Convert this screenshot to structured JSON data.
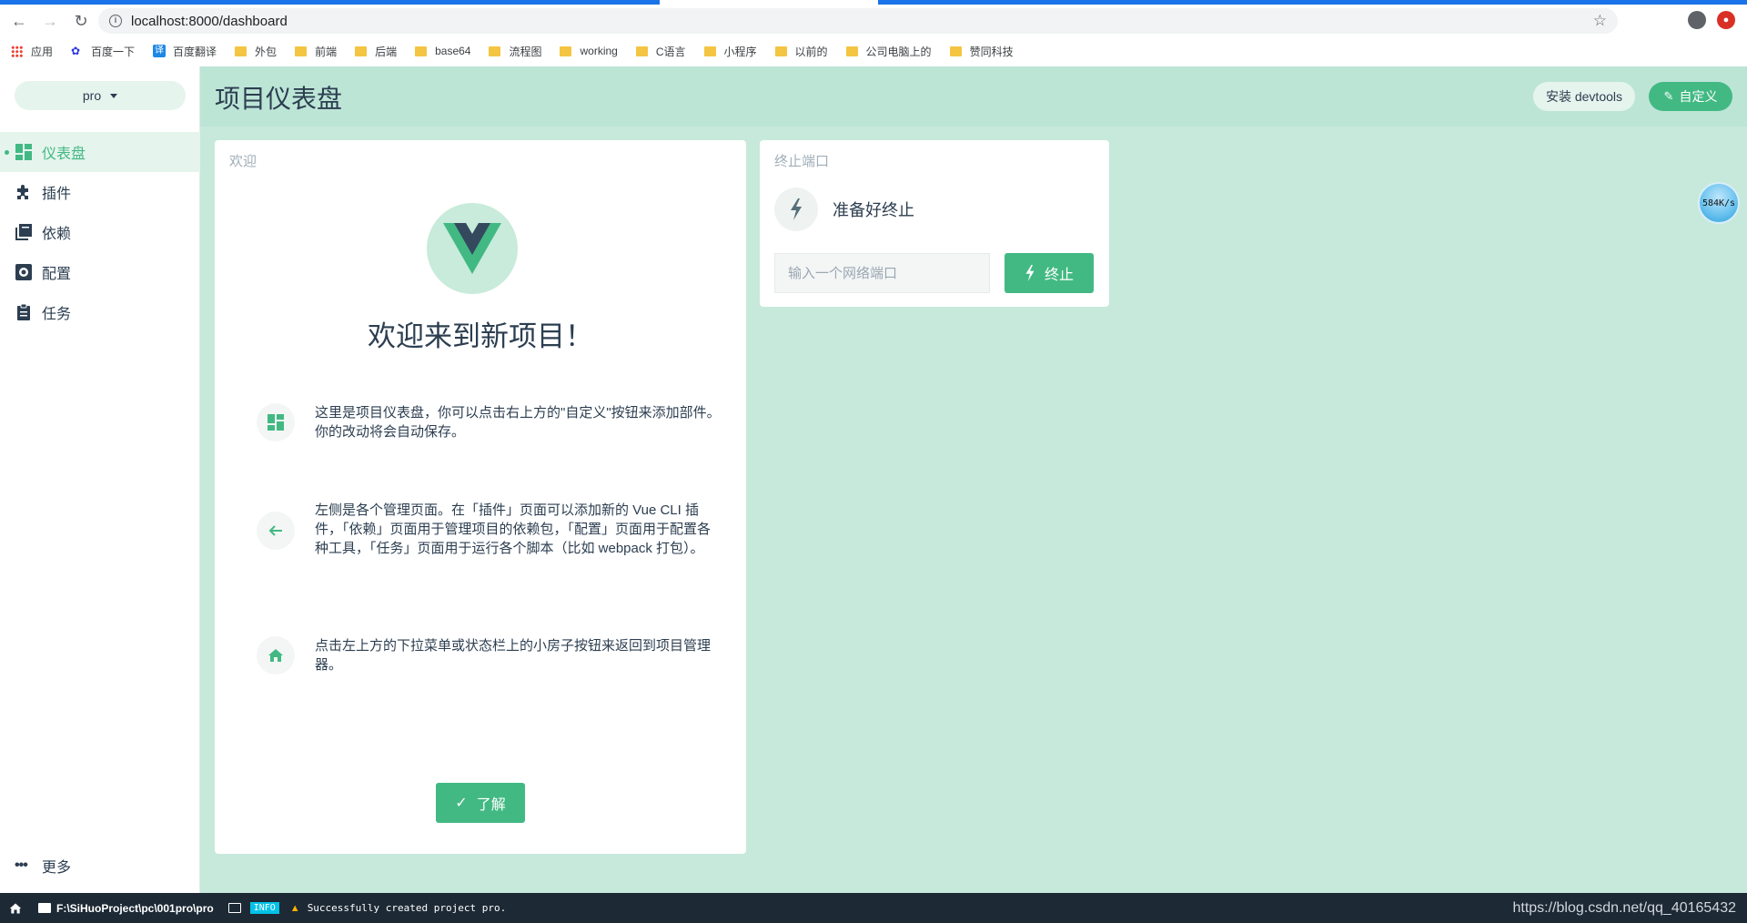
{
  "browser": {
    "url": "localhost:8000/dashboard",
    "bookmarks": [
      {
        "label": "应用",
        "icon": "apps-icon"
      },
      {
        "label": "百度一下",
        "icon": "baidu-paw-icon"
      },
      {
        "label": "百度翻译",
        "icon": "baidu-translate-icon"
      },
      {
        "label": "外包",
        "icon": "folder-icon"
      },
      {
        "label": "前端",
        "icon": "folder-icon"
      },
      {
        "label": "后端",
        "icon": "folder-icon"
      },
      {
        "label": "base64",
        "icon": "folder-icon"
      },
      {
        "label": "流程图",
        "icon": "folder-icon"
      },
      {
        "label": "working",
        "icon": "folder-icon"
      },
      {
        "label": "C语言",
        "icon": "folder-icon"
      },
      {
        "label": "小程序",
        "icon": "folder-icon"
      },
      {
        "label": "以前的",
        "icon": "folder-icon"
      },
      {
        "label": "公司电脑上的",
        "icon": "folder-icon"
      },
      {
        "label": "赞同科技",
        "icon": "folder-icon"
      }
    ]
  },
  "sidebar": {
    "project_name": "pro",
    "items": [
      {
        "label": "仪表盘",
        "icon": "dashboard-icon",
        "active": true
      },
      {
        "label": "插件",
        "icon": "puzzle-icon",
        "active": false
      },
      {
        "label": "依赖",
        "icon": "library-icon",
        "active": false
      },
      {
        "label": "配置",
        "icon": "settings-icon",
        "active": false
      },
      {
        "label": "任务",
        "icon": "clipboard-icon",
        "active": false
      }
    ],
    "more_label": "更多"
  },
  "header": {
    "title": "项目仪表盘",
    "devtools_label": "安装 devtools",
    "customize_label": "自定义"
  },
  "welcome": {
    "card_title": "欢迎",
    "heading": "欢迎来到新项目！",
    "tips": [
      {
        "icon": "dashboard-icon",
        "text": "这里是项目仪表盘，你可以点击右上方的\"自定义\"按钮来添加部件。你的改动将会自动保存。"
      },
      {
        "icon": "arrow-left-icon",
        "text": "左侧是各个管理页面。在「插件」页面可以添加新的 Vue CLI 插件，「依赖」页面用于管理项目的依赖包，「配置」页面用于配置各种工具，「任务」页面用于运行各个脚本（比如 webpack 打包）。"
      },
      {
        "icon": "home-icon",
        "text": "点击左上方的下拉菜单或状态栏上的小房子按钮来返回到项目管理器。"
      }
    ],
    "button_label": "了解"
  },
  "kill_port": {
    "card_title": "终止端口",
    "status": "准备好终止",
    "input_placeholder": "输入一个网络端口",
    "input_value": "",
    "button_label": "终止"
  },
  "speed_badge": "584K/s",
  "statusbar": {
    "path": "F:\\SiHuoProject\\pc\\001pro\\pro",
    "log_level": "INFO",
    "message": "Successfully created project pro.",
    "watermark": "https://blog.csdn.net/qq_40165432"
  },
  "colors": {
    "accent": "#42b983",
    "main_bg": "#c7e9dc",
    "statusbar_bg": "#1d2935"
  }
}
